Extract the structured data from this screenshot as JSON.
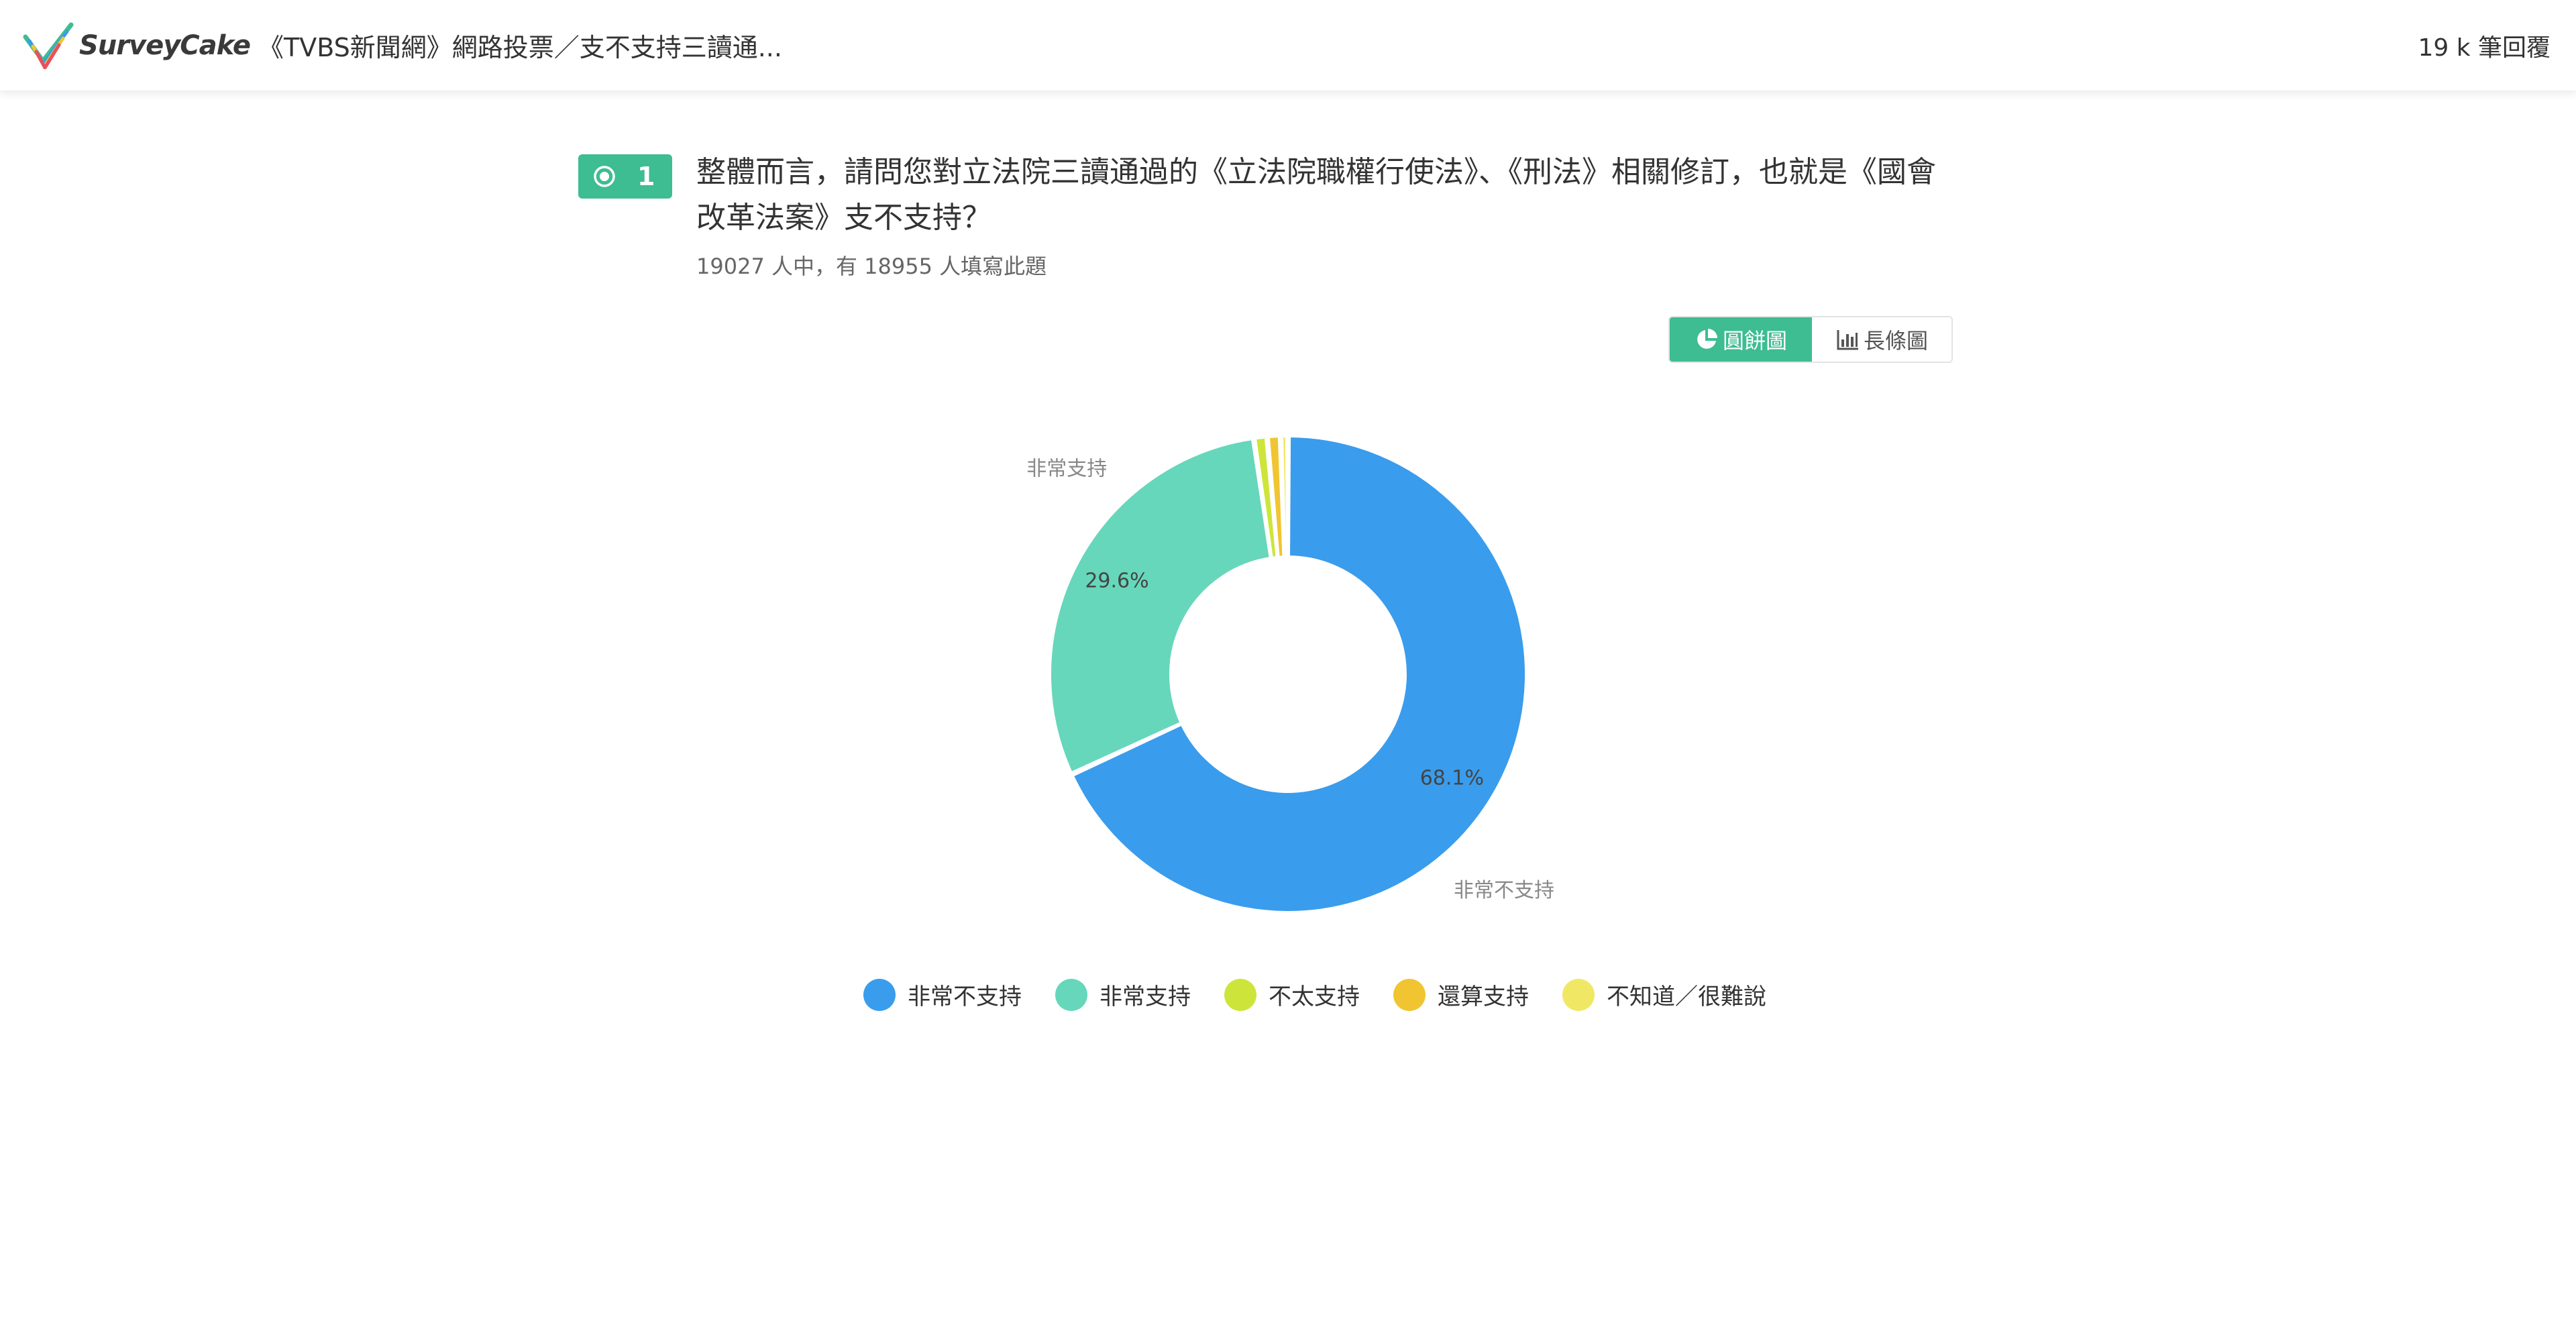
{
  "header": {
    "logo_text": "SurveyCake",
    "survey_title": "《TVBS新聞網》網路投票／支不支持三讀通...",
    "response_count": "19 k 筆回覆"
  },
  "question": {
    "number": "1",
    "text": "整體而言，請問您對立法院三讀通過的《立法院職權行使法》、《刑法》相關修訂，也就是《國會改革法案》支不支持？",
    "answered": "19027 人中，有 18955 人填寫此題"
  },
  "chart_toggle": {
    "pie_label": "圓餅圖",
    "bar_label": "長條圖",
    "selected": "pie"
  },
  "colors": {
    "accent": "#3dbd91"
  },
  "icons": {
    "logo": "surveycake-check-logo-icon",
    "question_type": "radio-icon",
    "pie": "pie-chart-icon",
    "bar": "bar-chart-icon"
  },
  "chart_data": {
    "type": "pie",
    "donut": true,
    "series": [
      {
        "name": "非常不支持",
        "value": 68.1,
        "label": "68.1%",
        "color": "#3a9cec"
      },
      {
        "name": "非常支持",
        "value": 29.6,
        "label": "29.6%",
        "color": "#66d7bb"
      },
      {
        "name": "不太支持",
        "value": 0.9,
        "label": "",
        "color": "#cde53b"
      },
      {
        "name": "還算支持",
        "value": 0.9,
        "label": "",
        "color": "#f0c531"
      },
      {
        "name": "不知道／很難說",
        "value": 0.5,
        "label": "",
        "color": "#f0e865"
      }
    ],
    "outer_labels": [
      "非常不支持",
      "非常支持"
    ],
    "legend_position": "bottom"
  }
}
